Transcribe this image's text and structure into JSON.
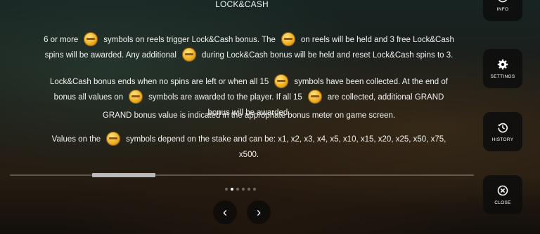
{
  "title": "LOCK&CASH",
  "paragraph1": {
    "a": "6 or more",
    "b": "symbols on reels trigger Lock&Cash bonus. The",
    "c": "on reels will be held and 3 free Lock&Cash spins will be awarded. Any additional",
    "d": "during Lock&Cash bonus will be held and reset Lock&Cash spins to 3."
  },
  "paragraph2": {
    "a": "Lock&Cash bonus ends when no spins are left or when all 15",
    "b": "symbols have been collected. At the end of bonus all values on",
    "c": "symbols are awarded to the player. If all 15",
    "d": "are collected, additional GRAND bonus will be awarded."
  },
  "paragraph3": "GRAND bonus value is indicated in the appropriate bonus meter on game screen.",
  "paragraph4": {
    "a": "Values on the",
    "b": "symbols depend on the stake and can be: x1, x2, x3, x4, x5, x10, x15, x20, x25, x50, x75, x500."
  },
  "icons": {
    "symbol": "gold-coin-icon",
    "prev": "chevron-left-icon",
    "next": "chevron-right-icon"
  },
  "pagination": {
    "count": 6,
    "active": 2
  },
  "prev_label": "‹",
  "next_label": "›",
  "sidebar": {
    "info": "INFO",
    "settings": "SETTINGS",
    "history": "HISTORY",
    "close": "CLOSE"
  }
}
